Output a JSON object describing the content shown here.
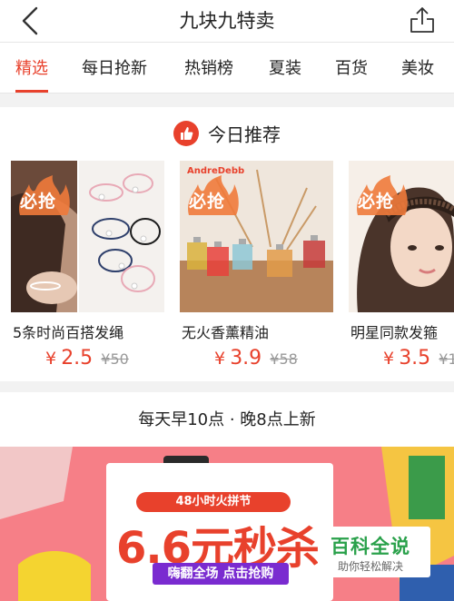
{
  "header": {
    "title": "九块九特卖"
  },
  "tabs": [
    {
      "label": "精选",
      "active": true
    },
    {
      "label": "每日抢新",
      "active": false
    },
    {
      "label": "热销榜",
      "active": false
    },
    {
      "label": "夏装",
      "active": false
    },
    {
      "label": "百货",
      "active": false
    },
    {
      "label": "美妆",
      "active": false
    }
  ],
  "recommend": {
    "title": "今日推荐",
    "badge_label": "必抢",
    "products": [
      {
        "name": "5条时尚百搭发绳",
        "currency": "¥",
        "price": "2.5",
        "old_price": "¥50"
      },
      {
        "name": "无火香薰精油",
        "currency": "¥",
        "price": "3.9",
        "old_price": "¥58",
        "brand_text": "AndreDebb"
      },
      {
        "name": "明星同款发箍",
        "currency": "¥",
        "price": "3.5",
        "old_price": "¥1"
      }
    ]
  },
  "daily_update": {
    "text": "每天早10点 · 晚8点上新"
  },
  "banner": {
    "ribbon": "48小时火拼节",
    "headline": "6.6元秒杀",
    "cta": "嗨翻全场 点击抢购"
  },
  "watermark": {
    "title": "百科全说",
    "subtitle": "助你轻松解决"
  },
  "colors": {
    "accent": "#e8412c",
    "banner_bg": "#f67f87",
    "watermark_green": "#2aa14b"
  }
}
